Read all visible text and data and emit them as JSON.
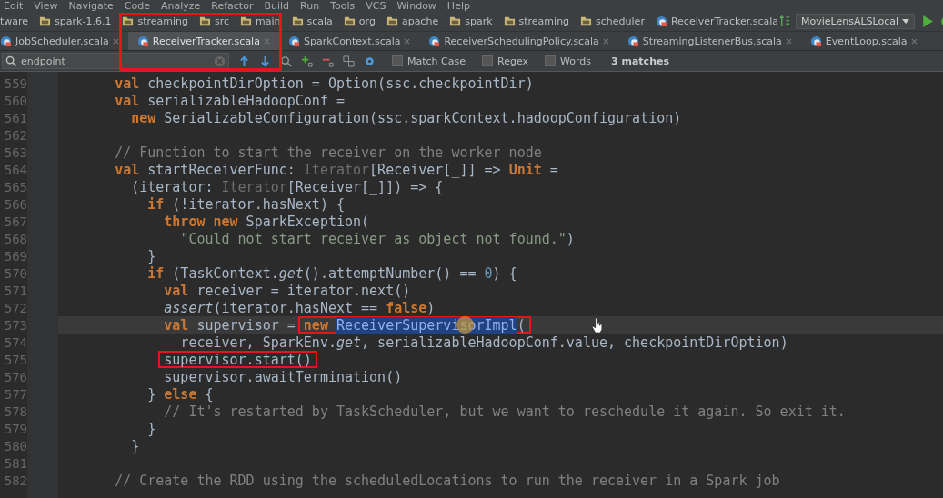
{
  "menu": [
    "Edit",
    "View",
    "Navigate",
    "Code",
    "Analyze",
    "Refactor",
    "Build",
    "Run",
    "Tools",
    "VCS",
    "Window",
    "Help"
  ],
  "breadcrumbs": [
    {
      "label": "tware",
      "kind": "plain"
    },
    {
      "label": "spark-1.6.1",
      "kind": "folder"
    },
    {
      "label": "streaming",
      "kind": "folder"
    },
    {
      "label": "src",
      "kind": "folder"
    },
    {
      "label": "main",
      "kind": "folder"
    },
    {
      "label": "scala",
      "kind": "folder"
    },
    {
      "label": "org",
      "kind": "folder"
    },
    {
      "label": "apache",
      "kind": "folder"
    },
    {
      "label": "spark",
      "kind": "folder"
    },
    {
      "label": "streaming",
      "kind": "folder"
    },
    {
      "label": "scheduler",
      "kind": "folder"
    },
    {
      "label": "ReceiverTracker.scala",
      "kind": "file"
    }
  ],
  "run_config": "MovieLensALSLocal",
  "tabs": [
    {
      "label": "JobScheduler.scala",
      "selected": false
    },
    {
      "label": "ReceiverTracker.scala",
      "selected": true
    },
    {
      "label": "SparkContext.scala",
      "selected": false
    },
    {
      "label": "ReceiverSchedulingPolicy.scala",
      "selected": false
    },
    {
      "label": "StreamingListenerBus.scala",
      "selected": false
    },
    {
      "label": "EventLoop.scala",
      "selected": false
    }
  ],
  "search": {
    "value": "endpoint",
    "options": [
      {
        "label": "Match Case",
        "checked": false
      },
      {
        "label": "Regex",
        "checked": false
      },
      {
        "label": "Words",
        "checked": false
      }
    ],
    "matches": "3 matches"
  },
  "lines": [
    {
      "number": "559",
      "current": false,
      "tokens": [
        {
          "text": "    val",
          "kind": "keyword"
        },
        {
          "text": " checkpointDirOption = Option(ssc.checkpointDir)",
          "kind": "plain"
        }
      ]
    },
    {
      "number": "560",
      "current": false,
      "tokens": [
        {
          "text": "    val",
          "kind": "keyword"
        },
        {
          "text": " serializableHadoopConf =",
          "kind": "plain"
        }
      ]
    },
    {
      "number": "561",
      "current": false,
      "tokens": [
        {
          "text": "      new",
          "kind": "keyword"
        },
        {
          "text": " SerializableConfiguration(ssc.sparkContext.hadoopConfiguration)",
          "kind": "plain"
        }
      ]
    },
    {
      "number": "562",
      "current": false
    },
    {
      "number": "563",
      "current": false,
      "tokens": [
        {
          "text": "    // Function to start the receiver on the worker node",
          "kind": "comment"
        }
      ]
    },
    {
      "number": "564",
      "current": false,
      "tokens": [
        {
          "text": "    val",
          "kind": "keyword"
        },
        {
          "text": " startReceiverFunc: ",
          "kind": "plain"
        },
        {
          "text": "Iterator",
          "kind": "type"
        },
        {
          "text": "[Receiver[_]] => ",
          "kind": "plain"
        },
        {
          "text": "Unit",
          "kind": "keyword"
        },
        {
          "text": " =",
          "kind": "plain"
        }
      ]
    },
    {
      "number": "565",
      "current": false,
      "tokens": [
        {
          "text": "      (iterator: ",
          "kind": "plain"
        },
        {
          "text": "Iterator",
          "kind": "type"
        },
        {
          "text": "[Receiver[_]]) => {",
          "kind": "plain"
        }
      ]
    },
    {
      "number": "566",
      "current": false,
      "tokens": [
        {
          "text": "        if",
          "kind": "keyword"
        },
        {
          "text": " (!iterator.hasNext) {",
          "kind": "plain"
        }
      ]
    },
    {
      "number": "567",
      "current": false,
      "tokens": [
        {
          "text": "          throw new",
          "kind": "keyword"
        },
        {
          "text": " SparkException(",
          "kind": "plain"
        }
      ]
    },
    {
      "number": "568",
      "current": false,
      "tokens": [
        {
          "text": "            \"Could not start receiver as object not found.\"",
          "kind": "string"
        },
        {
          "text": ")",
          "kind": "plain"
        }
      ]
    },
    {
      "number": "569",
      "current": false,
      "tokens": [
        {
          "text": "        }",
          "kind": "plain"
        }
      ]
    },
    {
      "number": "570",
      "current": false,
      "tokens": [
        {
          "text": "        if",
          "kind": "keyword"
        },
        {
          "text": " (TaskContext.",
          "kind": "plain"
        },
        {
          "text": "get",
          "kind": "italic"
        },
        {
          "text": "().attemptNumber() == ",
          "kind": "plain"
        },
        {
          "text": "0",
          "kind": "number"
        },
        {
          "text": ") {",
          "kind": "plain"
        }
      ]
    },
    {
      "number": "571",
      "current": false,
      "tokens": [
        {
          "text": "          val",
          "kind": "keyword"
        },
        {
          "text": " receiver = iterator.next()",
          "kind": "plain"
        }
      ]
    },
    {
      "number": "572",
      "current": false,
      "tokens": [
        {
          "text": "          assert",
          "kind": "italic"
        },
        {
          "text": "(iterator.hasNext == ",
          "kind": "plain"
        },
        {
          "text": "false",
          "kind": "keyword"
        },
        {
          "text": ")",
          "kind": "plain"
        }
      ]
    },
    {
      "number": "573",
      "current": true,
      "tokens": [
        {
          "text": "          val",
          "kind": "keyword"
        },
        {
          "text": " supervisor = ",
          "kind": "plain"
        },
        {
          "text": "new ",
          "kind": "keyword",
          "annotated": true
        },
        {
          "text": "ReceiverSupervisorImpl",
          "kind": "selected",
          "annotated": true
        },
        {
          "text": "(",
          "kind": "plain",
          "annotated": true
        }
      ]
    },
    {
      "number": "574",
      "current": false,
      "tokens": [
        {
          "text": "            receiver, SparkEnv.",
          "kind": "plain"
        },
        {
          "text": "get",
          "kind": "italic"
        },
        {
          "text": ", serializableHadoopConf.value, checkpointDirOption)",
          "kind": "plain"
        }
      ]
    },
    {
      "number": "575",
      "current": false,
      "tokens": [
        {
          "text": "          supervisor.start()",
          "kind": "plain",
          "annotated": true
        }
      ]
    },
    {
      "number": "576",
      "current": false,
      "tokens": [
        {
          "text": "          supervisor.awaitTermination()",
          "kind": "plain"
        }
      ]
    },
    {
      "number": "577",
      "current": false,
      "tokens": [
        {
          "text": "        }",
          "kind": "plain"
        },
        {
          "text": " else",
          "kind": "keyword"
        },
        {
          "text": " {",
          "kind": "plain"
        }
      ]
    },
    {
      "number": "578",
      "current": false,
      "tokens": [
        {
          "text": "          // It's restarted by TaskScheduler, but we want to reschedule it again. So exit it.",
          "kind": "comment"
        }
      ]
    },
    {
      "number": "579",
      "current": false,
      "tokens": [
        {
          "text": "        }",
          "kind": "plain"
        }
      ]
    },
    {
      "number": "580",
      "current": false,
      "tokens": [
        {
          "text": "      }",
          "kind": "plain"
        }
      ]
    },
    {
      "number": "581",
      "current": false
    },
    {
      "number": "582",
      "current": false,
      "tokens": [
        {
          "text": "    // Create the RDD using the scheduledLocations to run the receiver in a Spark job",
          "kind": "comment"
        }
      ]
    }
  ]
}
